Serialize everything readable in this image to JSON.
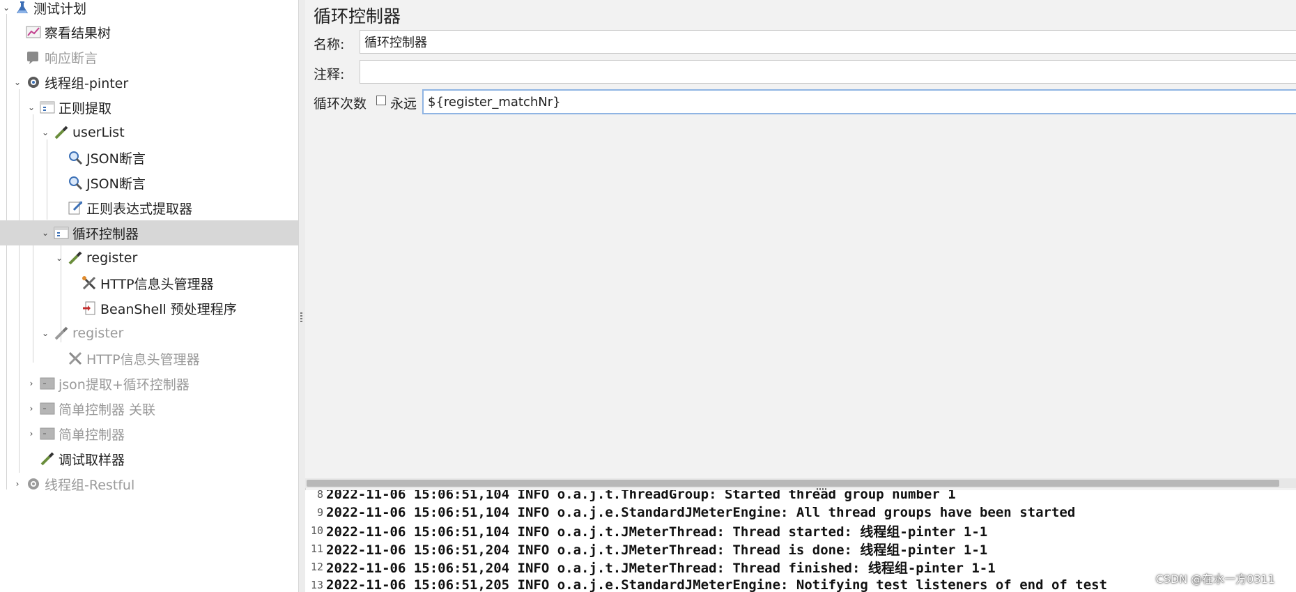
{
  "tree": {
    "items": [
      {
        "label": "测试计划",
        "icon": "test-plan-icon",
        "expanded": true
      },
      {
        "label": "察看结果树",
        "icon": "chart-icon"
      },
      {
        "label": "响应断言",
        "icon": "assertion-icon",
        "disabled": true
      },
      {
        "label": "线程组-pinter",
        "icon": "gear-icon",
        "expanded": true
      },
      {
        "label": "正则提取",
        "icon": "controller-icon",
        "expanded": true
      },
      {
        "label": "userList",
        "icon": "pipette-icon",
        "expanded": true
      },
      {
        "label": "JSON断言",
        "icon": "magnifier-icon"
      },
      {
        "label": "JSON断言",
        "icon": "magnifier-icon"
      },
      {
        "label": "正则表达式提取器",
        "icon": "extractor-icon"
      },
      {
        "label": "循环控制器",
        "icon": "controller-icon",
        "expanded": true,
        "selected": true
      },
      {
        "label": "register",
        "icon": "pipette-icon",
        "expanded": true
      },
      {
        "label": "HTTP信息头管理器",
        "icon": "tools-icon"
      },
      {
        "label": "BeanShell 预处理程序",
        "icon": "preprocessor-icon"
      },
      {
        "label": "register",
        "icon": "pipette-icon",
        "expanded": true,
        "disabled": true
      },
      {
        "label": "HTTP信息头管理器",
        "icon": "tools-icon",
        "disabled": true
      },
      {
        "label": "json提取+循环控制器",
        "icon": "controller-icon",
        "collapsed": true,
        "disabled": true
      },
      {
        "label": "简单控制器 关联",
        "icon": "controller-icon",
        "collapsed": true,
        "disabled": true
      },
      {
        "label": "简单控制器",
        "icon": "controller-icon",
        "collapsed": true,
        "disabled": true
      },
      {
        "label": "调试取样器",
        "icon": "pipette-icon"
      },
      {
        "label": "线程组-Restful",
        "icon": "gear-icon",
        "collapsed": true,
        "disabled": true
      }
    ]
  },
  "panel": {
    "title": "循环控制器",
    "name_label": "名称:",
    "name_value": "循环控制器",
    "comment_label": "注释:",
    "comment_value": "",
    "loop_label": "循环次数",
    "forever_label": "永远",
    "forever_checked": false,
    "loop_value": "${register_matchNr}"
  },
  "log": {
    "lines": [
      {
        "num": "8",
        "text": "2022-11-06 15:06:51,104 INFO o.a.j.t.ThreadGroup: Started thread group number 1"
      },
      {
        "num": "9",
        "text": "2022-11-06 15:06:51,104 INFO o.a.j.e.StandardJMeterEngine: All thread groups have been started"
      },
      {
        "num": "10",
        "text": "2022-11-06 15:06:51,104 INFO o.a.j.t.JMeterThread: Thread started: 线程组-pinter 1-1"
      },
      {
        "num": "11",
        "text": "2022-11-06 15:06:51,204 INFO o.a.j.t.JMeterThread: Thread is done: 线程组-pinter 1-1"
      },
      {
        "num": "12",
        "text": "2022-11-06 15:06:51,204 INFO o.a.j.t.JMeterThread: Thread finished: 线程组-pinter 1-1"
      },
      {
        "num": "13",
        "text": "2022-11-06 15:06:51,205 INFO o.a.j.e.StandardJMeterEngine: Notifying test listeners of end of test"
      }
    ]
  },
  "watermark": "CSDN @在水一方0311"
}
